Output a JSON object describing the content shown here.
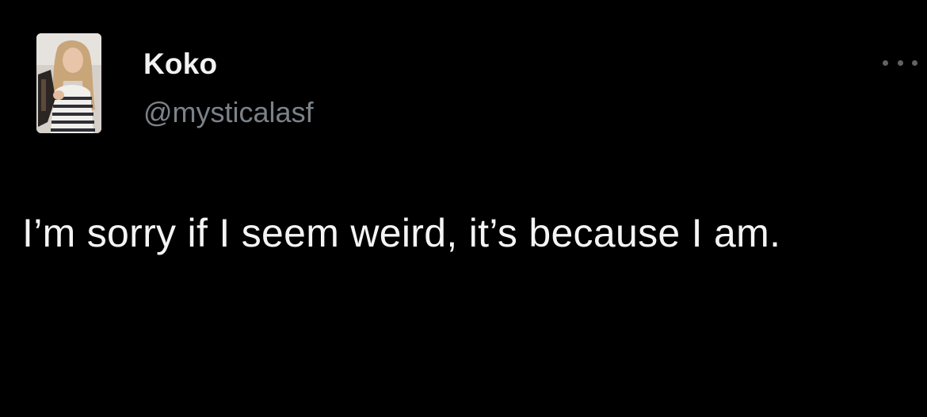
{
  "tweet": {
    "author": {
      "name": "Koko",
      "handle": "@mysticalasf",
      "avatar_icon": "profile-photo"
    },
    "more_icon": "ellipsis-icon",
    "text": "I’m sorry if I seem weird, it’s because I am."
  },
  "colors": {
    "background": "#000000",
    "name": "#f2f2f2",
    "handle": "#7b8288",
    "text": "#f4f4f4"
  }
}
